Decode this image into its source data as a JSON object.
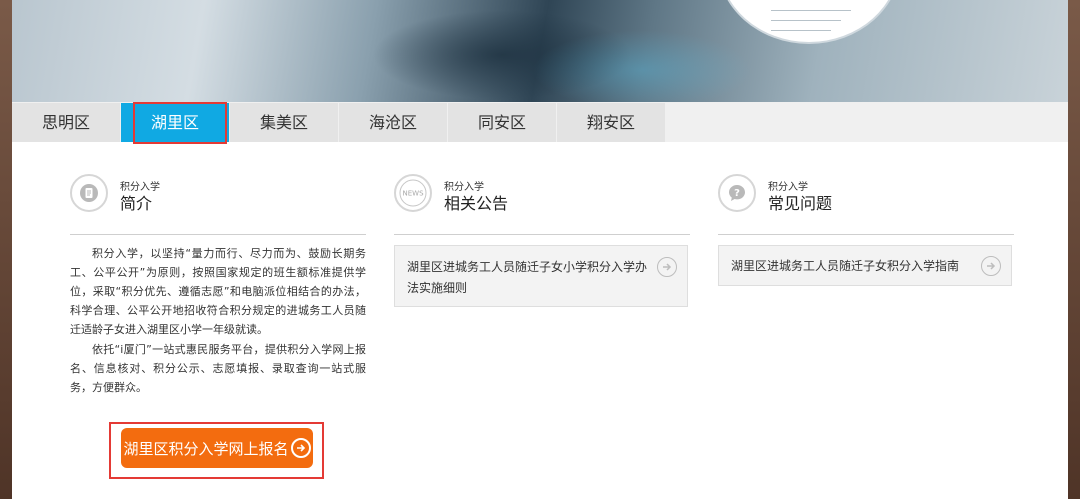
{
  "tabs": [
    {
      "label": "思明区",
      "active": false
    },
    {
      "label": "湖里区",
      "active": true
    },
    {
      "label": "集美区",
      "active": false
    },
    {
      "label": "海沧区",
      "active": false
    },
    {
      "label": "同安区",
      "active": false
    },
    {
      "label": "翔安区",
      "active": false
    }
  ],
  "colors": {
    "tab_active": "#10a9e3",
    "button": "#f36c0f",
    "highlight_box": "#e43a35"
  },
  "intro": {
    "small_label": "积分入学",
    "title": "简介",
    "icon": "document-icon",
    "paragraphs": [
      "积分入学，以坚持“量力而行、尽力而为、鼓励长期务工、公平公开”为原则，按照国家规定的班生额标准提供学位，采取“积分优先、遵循志愿”和电脑派位相结合的办法，科学合理、公平公开地招收符合积分规定的进城务工人员随迁适龄子女进入湖里区小学一年级就读。",
      "依托“i厦门”一站式惠民服务平台，提供积分入学网上报名、信息核对、积分公示、志愿填报、录取查询一站式服务，方便群众。"
    ],
    "button_label": "湖里区积分入学网上报名"
  },
  "notices": {
    "small_label": "积分入学",
    "title": "相关公告",
    "icon": "news-icon",
    "icon_text": "NEWS",
    "items": [
      "湖里区进城务工人员随迁子女小学积分入学办法实施细则"
    ]
  },
  "faq": {
    "small_label": "积分入学",
    "title": "常见问题",
    "icon": "question-icon",
    "items": [
      "湖里区进城务工人员随迁子女积分入学指南"
    ]
  }
}
